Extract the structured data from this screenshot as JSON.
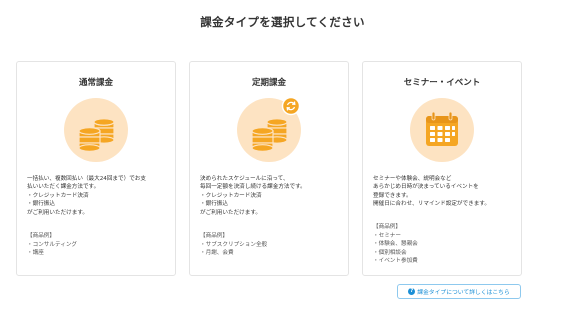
{
  "page_title": "課金タイプを選択してください",
  "cards": [
    {
      "title": "通常課金",
      "icon": "coins-icon",
      "description": "一括払い、複数回払い（最大24回まで）でお支\n払いいただく課金方法です。\n・クレジットカード決済\n・銀行振込\nがご利用いただけます。",
      "examples_title": "【商品例】",
      "examples": [
        "・コンサルティング",
        "・講座"
      ]
    },
    {
      "title": "定期課金",
      "icon": "coins-recurring-icon",
      "description": "決められたスケジュールに沿って、\n毎回一定額を決済し続ける課金方法です。\n・クレジットカード決済\n・銀行振込\nがご利用いただけます。",
      "examples_title": "【商品例】",
      "examples": [
        "・サブスクリプション全般",
        "・月謝、会費"
      ]
    },
    {
      "title": "セミナー・イベント",
      "icon": "calendar-icon",
      "description": "セミナーや体験会、説明会など\nあらかじめ日時が決まっているイベントを\n登録できます。\n開催日に合わせ、リマインド設定ができます。",
      "examples_title": "【商品例】",
      "examples": [
        "・セミナー",
        "・体験会、懇親会",
        "・個別相談会",
        "・イベント参加費"
      ]
    }
  ],
  "help_link": {
    "icon": "question-icon",
    "icon_glyph": "?",
    "label": "課金タイプについて詳しくはこちら"
  },
  "colors": {
    "accent_orange": "#f5a623",
    "icon_bg": "#fde3c2",
    "link_blue": "#1b8fd6"
  }
}
